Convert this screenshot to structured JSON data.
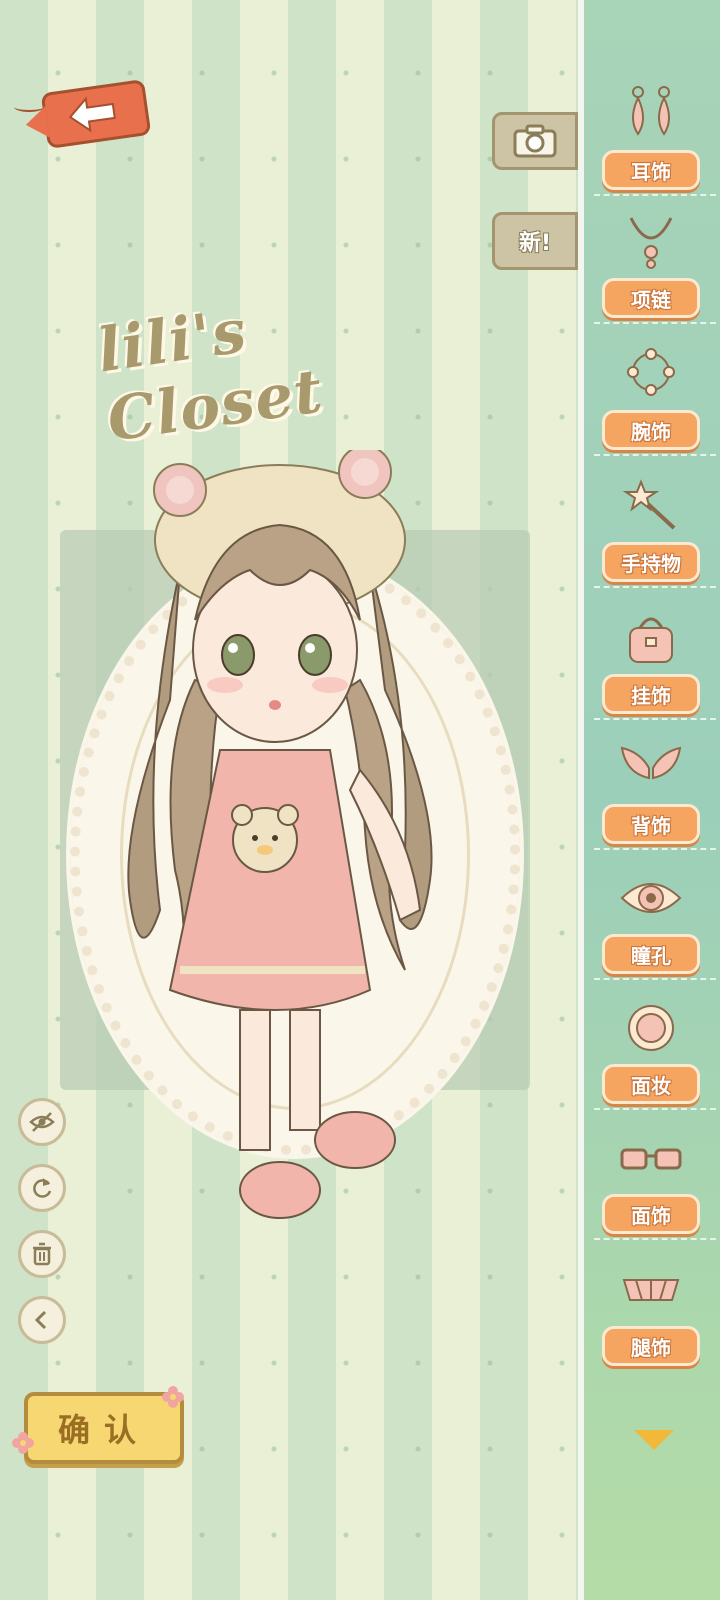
{
  "title": "lili's Closet",
  "top_buttons": {
    "new_label": "新!"
  },
  "sidebar": {
    "items": [
      {
        "label": "耳饰",
        "icon": "earring-icon"
      },
      {
        "label": "项链",
        "icon": "necklace-icon"
      },
      {
        "label": "腕饰",
        "icon": "bracelet-icon"
      },
      {
        "label": "手持物",
        "icon": "wand-icon"
      },
      {
        "label": "挂饰",
        "icon": "bag-icon"
      },
      {
        "label": "背饰",
        "icon": "wings-icon"
      },
      {
        "label": "瞳孔",
        "icon": "eye-icon"
      },
      {
        "label": "面妆",
        "icon": "compact-icon"
      },
      {
        "label": "面饰",
        "icon": "glasses-icon"
      },
      {
        "label": "腿饰",
        "icon": "leg-ribbon-icon"
      }
    ]
  },
  "tools": [
    "hide-icon",
    "rotate-icon",
    "trash-icon",
    "back-chevron-icon"
  ],
  "confirm_label": "确认",
  "colors": {
    "accent_orange": "#f5a55f",
    "confirm_yellow": "#f6d771",
    "back_tag": "#e8704c",
    "stripe_green": "#cfe3c9",
    "stripe_cream": "#e9f0d6"
  }
}
